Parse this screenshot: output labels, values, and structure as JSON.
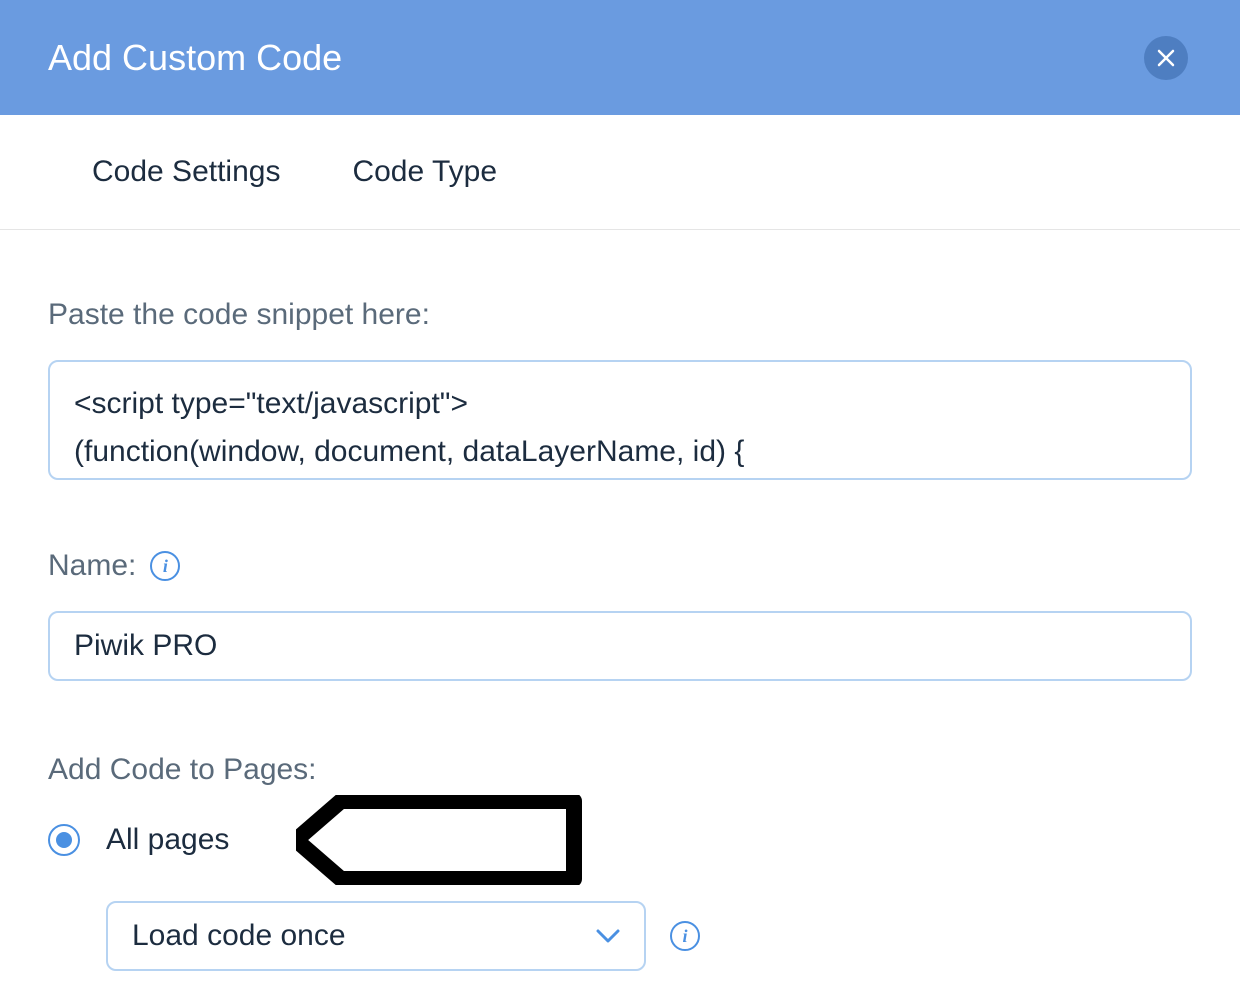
{
  "header": {
    "title": "Add Custom Code"
  },
  "tabs": {
    "code_settings": "Code Settings",
    "code_type": "Code Type"
  },
  "snippet": {
    "label": "Paste the code snippet here:",
    "value": "<script type=\"text/javascript\">\n(function(window, document, dataLayerName, id) {"
  },
  "name": {
    "label": "Name:",
    "value": "Piwik PRO"
  },
  "pages": {
    "label": "Add Code to Pages:",
    "radio_all_pages": "All pages",
    "dropdown_value": "Load code once"
  }
}
